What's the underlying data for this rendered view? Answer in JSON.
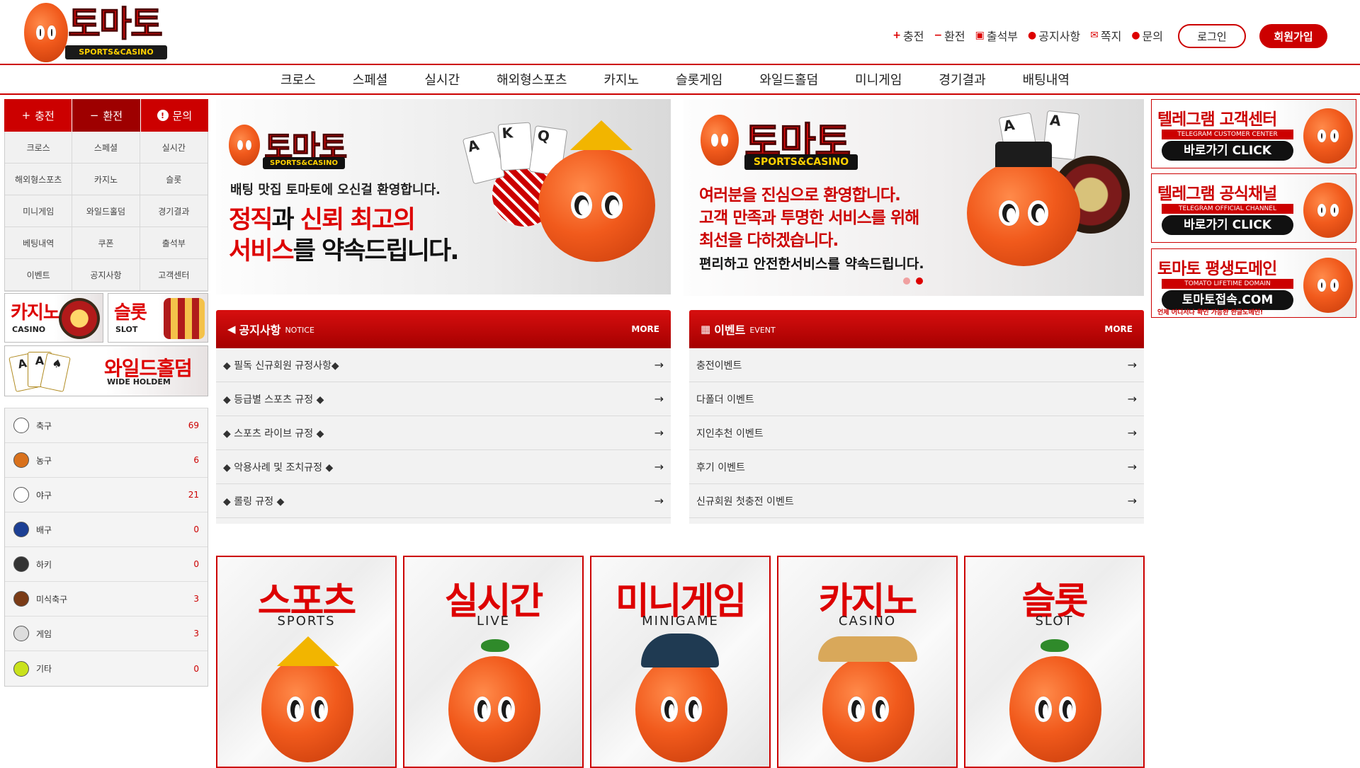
{
  "header": {
    "logo_title": "토마토",
    "logo_sub": "SPORTS&CASINO",
    "links": [
      {
        "icon": "plus",
        "label": "충전"
      },
      {
        "icon": "minus",
        "label": "환전"
      },
      {
        "icon": "calendar",
        "label": "출석부"
      },
      {
        "icon": "alert",
        "label": "공지사항"
      },
      {
        "icon": "mail",
        "label": "쪽지"
      },
      {
        "icon": "chat",
        "label": "문의"
      }
    ],
    "login": "로그인",
    "join": "회원가입"
  },
  "nav": [
    "크로스",
    "스페셜",
    "실시간",
    "해외형스포츠",
    "카지노",
    "슬롯게임",
    "와일드홀덤",
    "미니게임",
    "경기결과",
    "배팅내역"
  ],
  "sidebar": {
    "quick": [
      {
        "icon": "+",
        "label": "충전"
      },
      {
        "icon": "−",
        "label": "환전"
      },
      {
        "icon": "!",
        "label": "문의"
      }
    ],
    "menu": [
      "크로스",
      "스페셜",
      "실시간",
      "해외형스포츠",
      "카지노",
      "슬롯",
      "미니게임",
      "와일드홀덤",
      "경기결과",
      "베팅내역",
      "쿠폰",
      "출석부",
      "이벤트",
      "공지사항",
      "고객센터"
    ],
    "casino_banner": {
      "big": "카지노",
      "small": "CASINO"
    },
    "slot_banner": {
      "big": "슬롯",
      "small": "SLOT"
    },
    "holdem_banner": {
      "big": "와일드홀덤",
      "small": "WIDE HOLDEM"
    },
    "sports": [
      {
        "name": "축구",
        "count": "69",
        "icon": "soccer-ball-icon",
        "color": "#ffffff"
      },
      {
        "name": "농구",
        "count": "6",
        "icon": "basketball-icon",
        "color": "#d9711c"
      },
      {
        "name": "야구",
        "count": "21",
        "icon": "baseball-icon",
        "color": "#ffffff"
      },
      {
        "name": "배구",
        "count": "0",
        "icon": "volleyball-icon",
        "color": "#1c3f94"
      },
      {
        "name": "하키",
        "count": "0",
        "icon": "hockey-puck-icon",
        "color": "#333333"
      },
      {
        "name": "미식축구",
        "count": "3",
        "icon": "football-icon",
        "color": "#7a3b16"
      },
      {
        "name": "게임",
        "count": "3",
        "icon": "gamepad-icon",
        "color": "#dddddd"
      },
      {
        "name": "기타",
        "count": "0",
        "icon": "tennis-ball-icon",
        "color": "#c9e21c"
      }
    ]
  },
  "hero1": {
    "logo_title": "토마토",
    "logo_sub": "SPORTS&CASINO",
    "line1": "배팅 맛집 토마토에 오신걸 환영합니다.",
    "line2_a": "정직",
    "line2_b": "과 ",
    "line2_c": "신뢰 최고의",
    "line3_a": "서비스",
    "line3_b": "를 약속드립니다."
  },
  "hero2": {
    "logo_title": "토마토",
    "logo_sub": "SPORTS&CASINO",
    "p1": "여러분을 진심으로 환영합니다.",
    "p2": "고객 만족과 투명한 서비스를 위해",
    "p3": "최선을 다하겠습니다.",
    "p4": "편리하고 안전한서비스를 약속드립니다."
  },
  "notice": {
    "title": "공지사항",
    "title_en": "NOTICE",
    "more": "MORE",
    "items": [
      "◆ 필독 신규회원 규정사항◆",
      "◆ 등급별 스포츠 규정 ◆",
      "◆ 스포츠 라이브 규정 ◆",
      "◆ 악용사례 및 조치규정 ◆",
      "◆ 롤링 규정 ◆"
    ]
  },
  "event": {
    "title": "이벤트",
    "title_en": "EVENT",
    "more": "MORE",
    "items": [
      "충전이벤트",
      "다폴더 이벤트",
      "지인추천 이벤트",
      "후기 이벤트",
      "신규회원 첫충전 이벤트"
    ]
  },
  "games": [
    {
      "ko": "스포츠",
      "en": "SPORTS"
    },
    {
      "ko": "실시간",
      "en": "LIVE"
    },
    {
      "ko": "미니게임",
      "en": "MINIGAME"
    },
    {
      "ko": "카지노",
      "en": "CASINO"
    },
    {
      "ko": "슬롯",
      "en": "SLOT"
    }
  ],
  "right_banners": [
    {
      "title": "텔레그램 고객센터",
      "sub": "TELEGRAM CUSTOMER CENTER",
      "cta": "바로가기 CLICK",
      "note": ""
    },
    {
      "title": "텔레그램 공식채널",
      "sub": "TELEGRAM OFFICIAL CHANNEL",
      "cta": "바로가기 CLICK",
      "note": ""
    },
    {
      "title": "토마토 평생도메인",
      "sub": "TOMATO LIFETIME DOMAIN",
      "cta": "토마토접속.COM",
      "note": "언제 어디서나 확인 가능한 한글도메인!"
    }
  ],
  "colors": {
    "brand_red": "#cc0000",
    "dark_red": "#a50000",
    "gold": "#ffd000"
  }
}
